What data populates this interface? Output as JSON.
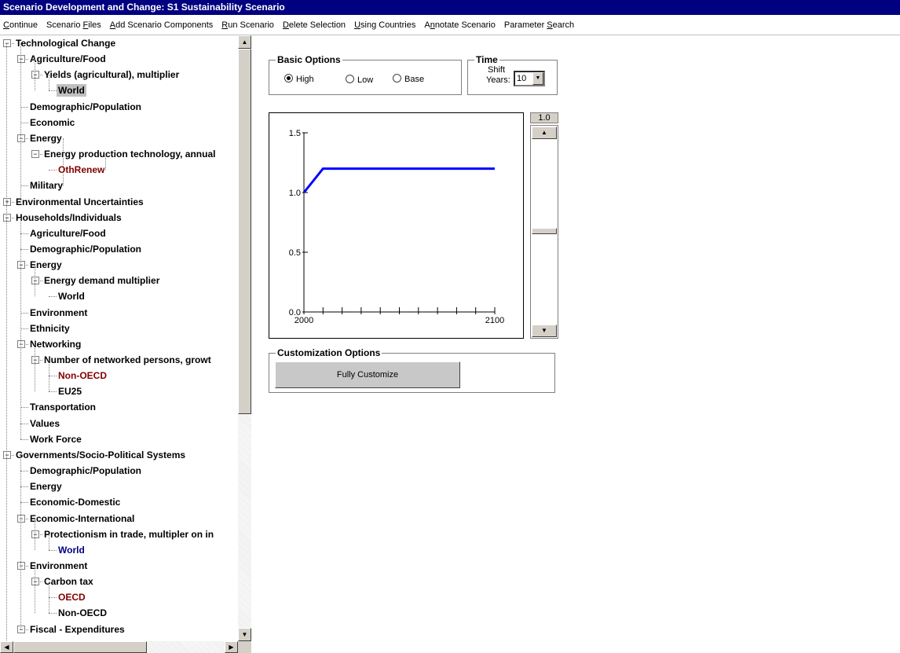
{
  "window": {
    "title": "Scenario Development and Change: S1 Sustainability Scenario"
  },
  "menu": [
    {
      "pre": "",
      "u": "C",
      "post": "ontinue"
    },
    {
      "pre": "Scenario ",
      "u": "F",
      "post": "iles"
    },
    {
      "pre": "",
      "u": "A",
      "post": "dd Scenario Components"
    },
    {
      "pre": "",
      "u": "R",
      "post": "un Scenario"
    },
    {
      "pre": "",
      "u": "D",
      "post": "elete Selection"
    },
    {
      "pre": "",
      "u": "U",
      "post": "sing Countries"
    },
    {
      "pre": "A",
      "u": "n",
      "post": "notate Scenario"
    },
    {
      "pre": "Parameter ",
      "u": "S",
      "post": "earch"
    }
  ],
  "tree": [
    {
      "label": "Technological Change",
      "level": 0,
      "exp": "-"
    },
    {
      "label": "Agriculture/Food",
      "level": 1,
      "exp": "-"
    },
    {
      "label": "Yields (agricultural), multiplier",
      "level": 2,
      "exp": "-"
    },
    {
      "label": "World",
      "level": 3,
      "selected": true
    },
    {
      "label": "Demographic/Population",
      "level": 1
    },
    {
      "label": "Economic",
      "level": 1
    },
    {
      "label": "Energy",
      "level": 1,
      "exp": "-"
    },
    {
      "label": "Energy production technology, annual",
      "level": 2,
      "exp": "-"
    },
    {
      "label": "OthRenew",
      "level": 3,
      "color": "red"
    },
    {
      "label": "Military",
      "level": 1
    },
    {
      "label": "Environmental Uncertainties",
      "level": 0,
      "exp": "+"
    },
    {
      "label": "Households/Individuals",
      "level": 0,
      "exp": "-"
    },
    {
      "label": "Agriculture/Food",
      "level": 1
    },
    {
      "label": "Demographic/Population",
      "level": 1
    },
    {
      "label": "Energy",
      "level": 1,
      "exp": "-"
    },
    {
      "label": "Energy demand multiplier",
      "level": 2,
      "exp": "-"
    },
    {
      "label": "World",
      "level": 3
    },
    {
      "label": "Environment",
      "level": 1
    },
    {
      "label": "Ethnicity",
      "level": 1
    },
    {
      "label": "Networking",
      "level": 1,
      "exp": "-"
    },
    {
      "label": "Number of networked persons, growt",
      "level": 2,
      "exp": "-"
    },
    {
      "label": "Non-OECD",
      "level": 3,
      "color": "red"
    },
    {
      "label": "EU25",
      "level": 3
    },
    {
      "label": "Transportation",
      "level": 1
    },
    {
      "label": "Values",
      "level": 1
    },
    {
      "label": "Work Force",
      "level": 1
    },
    {
      "label": "Governments/Socio-Political Systems",
      "level": 0,
      "exp": "-"
    },
    {
      "label": "Demographic/Population",
      "level": 1
    },
    {
      "label": "Energy",
      "level": 1
    },
    {
      "label": "Economic-Domestic",
      "level": 1
    },
    {
      "label": "Economic-International",
      "level": 1,
      "exp": "-"
    },
    {
      "label": "Protectionism in trade, multipler on in",
      "level": 2,
      "exp": "-"
    },
    {
      "label": "World",
      "level": 3,
      "color": "blue"
    },
    {
      "label": "Environment",
      "level": 1,
      "exp": "-"
    },
    {
      "label": "Carbon tax",
      "level": 2,
      "exp": "-"
    },
    {
      "label": "OECD",
      "level": 3,
      "color": "red"
    },
    {
      "label": "Non-OECD",
      "level": 3
    },
    {
      "label": "Fiscal - Expenditures",
      "level": 1,
      "exp": "-"
    }
  ],
  "basic_options": {
    "title": "Basic Options",
    "high": "High",
    "low": "Low",
    "base": "Base",
    "selected": "High"
  },
  "time": {
    "title": "Time",
    "shift_label_1": "Shift",
    "years_label": "Years:",
    "value": "10"
  },
  "slider": {
    "value_label": "1.0"
  },
  "customization": {
    "title": "Customization Options",
    "button": "Fully Customize"
  },
  "chart_data": {
    "type": "line",
    "x": [
      2000,
      2010,
      2100
    ],
    "series": [
      {
        "values": [
          1.0,
          1.2,
          1.2
        ],
        "color": "#0000ff"
      }
    ],
    "xlim": [
      2000,
      2100
    ],
    "ylim": [
      0,
      1.5
    ],
    "xtick_labels": [
      "2000",
      "2100"
    ],
    "ytick_labels": [
      "0.0",
      "0.5",
      "1.0",
      "1.5"
    ],
    "yticks": [
      0,
      0.5,
      1.0,
      1.5
    ],
    "xticks": [
      2000,
      2010,
      2020,
      2030,
      2040,
      2050,
      2060,
      2070,
      2080,
      2090,
      2100
    ],
    "grid": false
  }
}
